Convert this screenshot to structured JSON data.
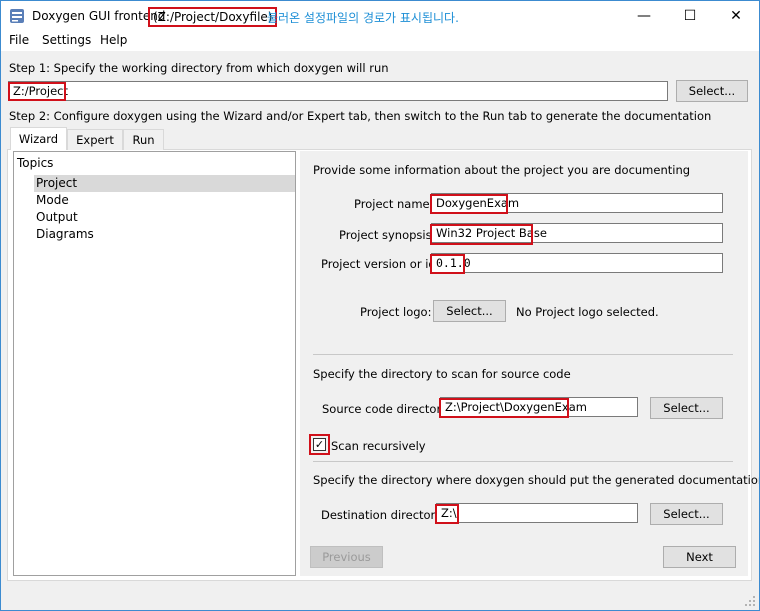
{
  "window": {
    "title": "Doxygen GUI frontend",
    "title_path": "(Z:/Project/Doxyfile)",
    "annotation": "불러온 설정파일의 경로가 표시됩니다.",
    "minimize": "—",
    "maximize": "☐",
    "close": "✕"
  },
  "menu": [
    "File",
    "Settings",
    "Help"
  ],
  "step1": {
    "label": "Step 1: Specify the working directory from which doxygen will run",
    "value": "Z:/Project",
    "button": "Select..."
  },
  "step2": {
    "label": "Step 2: Configure doxygen using the Wizard and/or Expert tab, then switch to the Run tab to generate the documentation"
  },
  "tabs": [
    "Wizard",
    "Expert",
    "Run"
  ],
  "topics": {
    "header": "Topics",
    "items": [
      "Project",
      "Mode",
      "Output",
      "Diagrams"
    ],
    "selected": "Project"
  },
  "project": {
    "intro": "Provide some information about the project you are documenting",
    "name_label": "Project name:",
    "name_value": "DoxygenExam",
    "synopsis_label": "Project synopsis:",
    "synopsis_value": "Win32 Project Base",
    "version_label": "Project version or id:",
    "version_value": "0.1.0",
    "logo_label": "Project logo:",
    "logo_button": "Select...",
    "logo_status": "No Project logo selected.",
    "source_intro": "Specify the directory to scan for source code",
    "source_label": "Source code directory:",
    "source_value": "Z:\\Project\\DoxygenExam",
    "source_button": "Select...",
    "scan_recursively_label": "Scan recursively",
    "scan_recursively_checked": true,
    "dest_intro": "Specify the directory where doxygen should put the generated documentation",
    "dest_label": "Destination directory:",
    "dest_value": "Z:\\",
    "dest_button": "Select..."
  },
  "nav": {
    "previous": "Previous",
    "next": "Next"
  },
  "colors": {
    "highlight": "#d0101a",
    "annotation": "#1e8fd6"
  }
}
